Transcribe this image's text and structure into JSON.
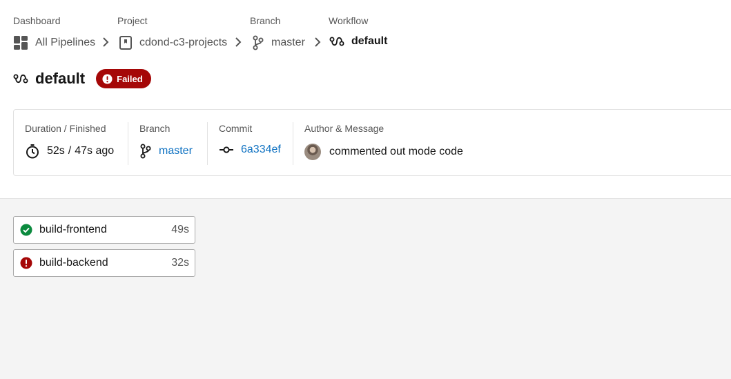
{
  "breadcrumb": {
    "dashboard": {
      "caption": "Dashboard",
      "label": "All Pipelines"
    },
    "project": {
      "caption": "Project",
      "label": "cdond-c3-projects"
    },
    "branch": {
      "caption": "Branch",
      "label": "master"
    },
    "workflow": {
      "caption": "Workflow",
      "label": "default"
    }
  },
  "header": {
    "title": "default",
    "status": "Failed",
    "status_color": "#a50707"
  },
  "info": {
    "duration": {
      "caption": "Duration / Finished",
      "duration": "52s",
      "separator": "/",
      "finished": "47s ago"
    },
    "branch": {
      "caption": "Branch",
      "value": "master"
    },
    "commit": {
      "caption": "Commit",
      "value": "6a334ef"
    },
    "author": {
      "caption": "Author & Message",
      "message": "commented out mode code"
    }
  },
  "jobs": [
    {
      "name": "build-frontend",
      "duration": "49s",
      "status": "success",
      "color": "#0b8a3e"
    },
    {
      "name": "build-backend",
      "duration": "32s",
      "status": "failed",
      "color": "#a50707"
    }
  ],
  "colors": {
    "link": "#0f72c2",
    "failed": "#a50707",
    "success": "#0b8a3e"
  }
}
